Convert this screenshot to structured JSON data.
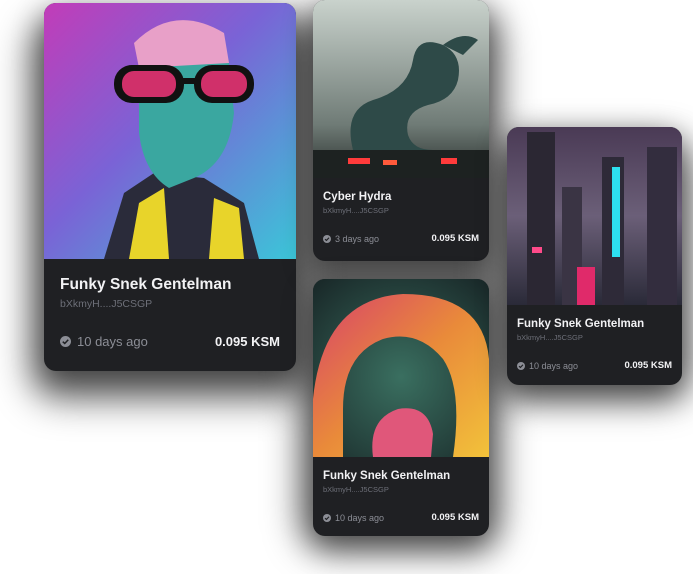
{
  "cards": [
    {
      "title": "Funky Snek Gentelman",
      "owner": "bXkmyH....J5CSGP",
      "time": "10 days ago",
      "price": "0.095 KSM"
    },
    {
      "title": "Cyber Hydra",
      "owner": "bXkmyH....J5CSGP",
      "time": "3 days ago",
      "price": "0.095 KSM"
    },
    {
      "title": "Funky Snek Gentelman",
      "owner": "bXkmyH....J5CSGP",
      "time": "10 days ago",
      "price": "0.095 KSM"
    },
    {
      "title": "Funky Snek Gentelman",
      "owner": "bXkmyH....J5CSGP",
      "time": "10 days ago",
      "price": "0.095 KSM"
    }
  ],
  "colors": {
    "card_bg": "#1f2023",
    "text": "#f2f2f4",
    "muted": "#8c8e96"
  },
  "icons": [
    "check-circle-icon"
  ]
}
